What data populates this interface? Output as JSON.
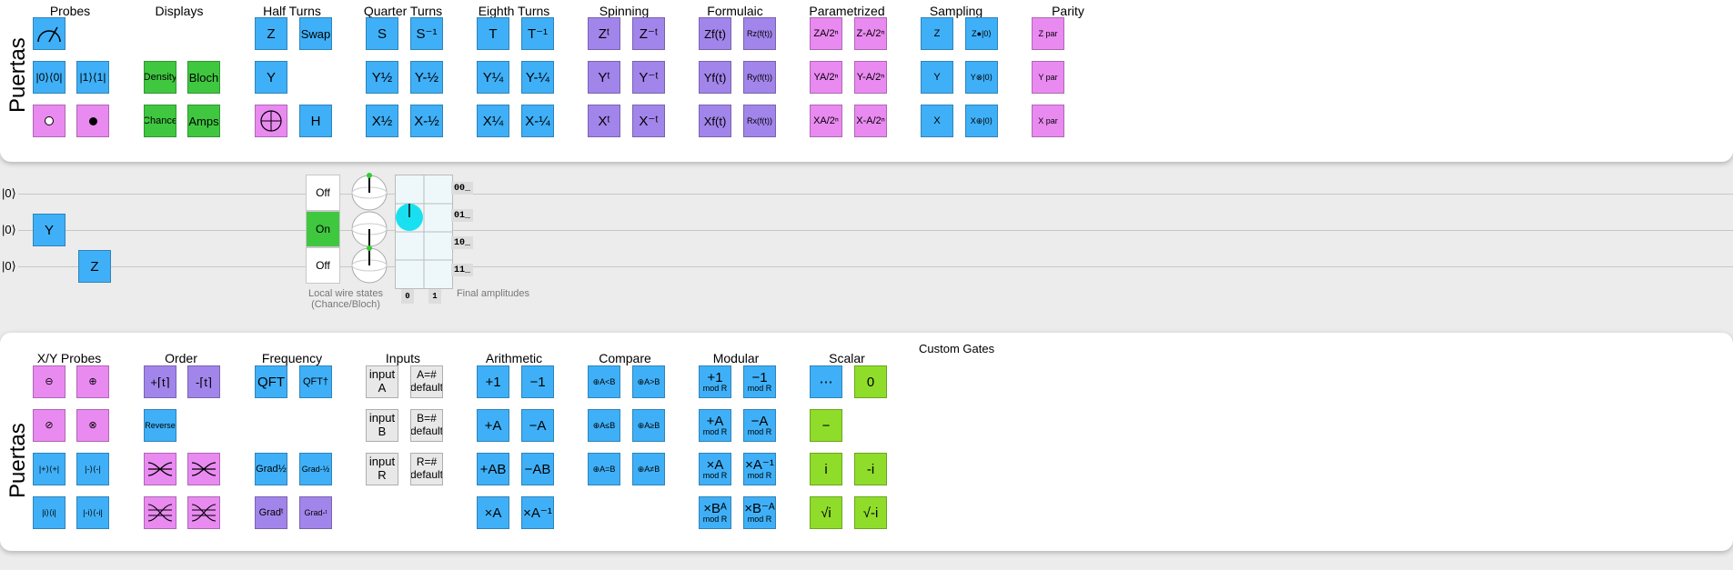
{
  "top": {
    "side_title": "Puertas",
    "groups": {
      "probes": "Probes",
      "displays": "Displays",
      "half_turns": "Half Turns",
      "quarter_turns": "Quarter Turns",
      "eighth_turns": "Eighth Turns",
      "spinning": "Spinning",
      "formulaic": "Formulaic",
      "parametrized": "Parametrized",
      "sampling": "Sampling",
      "parity": "Parity"
    },
    "gates": {
      "p00": "|0⟩⟨0|",
      "p01": "|1⟩⟨1|",
      "d_density": "Density",
      "d_bloch": "Bloch",
      "d_chance": "Chance",
      "d_amps": "Amps",
      "h_z": "Z",
      "h_swap": "Swap",
      "h_y": "Y",
      "h_h": "H",
      "q_s": "S",
      "q_sinv": "S⁻¹",
      "q_yh": "Y½",
      "q_ymh": "Y-½",
      "q_xh": "X½",
      "q_xmh": "X-½",
      "e_t": "T",
      "e_tinv": "T⁻¹",
      "e_yq": "Y¼",
      "e_ymq": "Y-¼",
      "e_xq": "X¼",
      "e_xmq": "X-¼",
      "s_zt": "Zᵗ",
      "s_zmt": "Z⁻ᵗ",
      "s_yt": "Yᵗ",
      "s_ymt": "Y⁻ᵗ",
      "s_xt": "Xᵗ",
      "s_xmt": "X⁻ᵗ",
      "f_z": "Zf(t)",
      "f_rz": "Rz(f(t))",
      "f_y": "Yf(t)",
      "f_ry": "Ry(f(t))",
      "f_x": "Xf(t)",
      "f_rx": "Rx(f(t))",
      "pa_z": "ZA/2ⁿ",
      "pa_zm": "Z-A/2ⁿ",
      "pa_y": "YA/2ⁿ",
      "pa_ym": "Y-A/2ⁿ",
      "pa_x": "XA/2ⁿ",
      "pa_xm": "X-A/2ⁿ",
      "sa_z": "Z",
      "sa_z0": "Z●|0⟩",
      "sa_y": "Y",
      "sa_y0": "Y⊗|0⟩",
      "sa_x": "X",
      "sa_x0": "X⊕|0⟩",
      "par_z": "Z par",
      "par_y": "Y par",
      "par_x": "X par"
    }
  },
  "circuit": {
    "wires": [
      "|0⟩",
      "|0⟩",
      "|0⟩"
    ],
    "gate_y": "Y",
    "gate_z": "Z",
    "states": [
      "Off",
      "On",
      "Off"
    ],
    "amp_labels": [
      "00_",
      "01_",
      "10_",
      "11_"
    ],
    "col_labels": [
      "0",
      "1"
    ],
    "caption_local": "Local wire states\n(Chance/Bloch)",
    "caption_final": "Final amplitudes"
  },
  "bottom": {
    "side_title": "Puertas",
    "custom_gates": "Custom Gates",
    "groups": {
      "xy": "X/Y Probes",
      "order": "Order",
      "frequency": "Frequency",
      "inputs": "Inputs",
      "arithmetic": "Arithmetic",
      "compare": "Compare",
      "modular": "Modular",
      "scalar": "Scalar"
    },
    "gates": {
      "xy_a": "⊖",
      "xy_b": "⊕",
      "xy_c": "⊘",
      "xy_d": "⊗",
      "xy_e": "|+⟩⟨+|",
      "xy_f": "|-⟩⟨-|",
      "xy_g": "|i⟩⟨i|",
      "xy_h": "|-i⟩⟨-i|",
      "o_a": "+⌈t⌉",
      "o_b": "-⌈t⌉",
      "o_rev": "Reverse",
      "fr_qft": "QFT",
      "fr_qftd": "QFT†",
      "fr_g1": "Grad½",
      "fr_g2": "Grad-½",
      "fr_g3": "Gradᵗ",
      "fr_g4": "Grad-ᵗ",
      "in_a": "input A",
      "in_ad": "A=# default",
      "in_b": "input B",
      "in_bd": "B=# default",
      "in_r": "input R",
      "in_rd": "R=# default",
      "ar_inc": "+1",
      "ar_dec": "−1",
      "ar_pa": "+A",
      "ar_ma": "−A",
      "ar_pab": "+AB",
      "ar_mab": "−AB",
      "ar_xa": "×A",
      "ar_xai": "×A⁻¹",
      "c_lt": "⊕A<B",
      "c_gt": "⊕A>B",
      "c_le": "⊕A≤B",
      "c_ge": "⊕A≥B",
      "c_eq": "⊕A=B",
      "c_ne": "⊕A≠B",
      "m_inc": "+1",
      "m_dec": "−1",
      "m_pa": "+A",
      "m_ma": "−A",
      "m_xa": "×A",
      "m_xai": "×A⁻¹",
      "m_xba": "×Bᴬ",
      "m_xbma": "×B⁻ᴬ",
      "mod_r": "mod R",
      "sc_dots": "⋯",
      "sc_0": "0",
      "sc_minus": "−",
      "sc_i": "i",
      "sc_mi": "-i",
      "sc_si": "√i",
      "sc_smi": "√-i"
    }
  },
  "colors": {
    "blue": "#3fb0f7",
    "purple": "#a285ea",
    "pink": "#e98af1",
    "green": "#40c740",
    "lime": "#8fdd2a"
  }
}
